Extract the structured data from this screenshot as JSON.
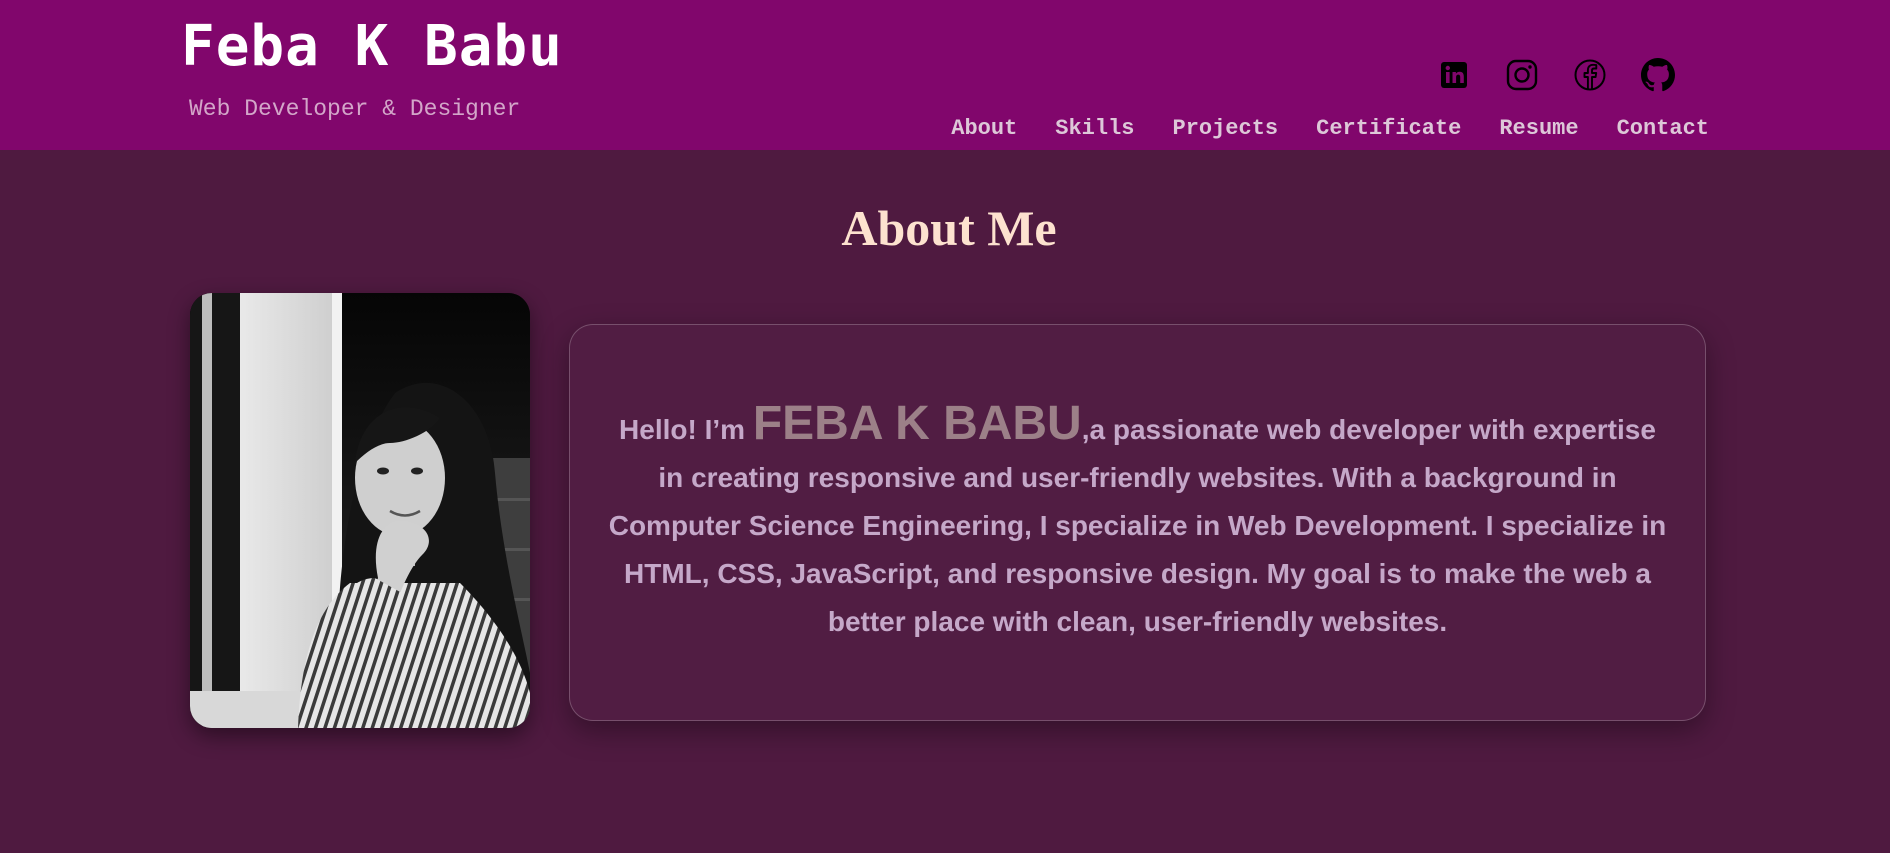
{
  "header": {
    "name": "Feba K Babu",
    "tagline": "Web Developer & Designer",
    "socials": [
      {
        "icon": "linkedin-icon"
      },
      {
        "icon": "instagram-icon"
      },
      {
        "icon": "facebook-icon"
      },
      {
        "icon": "github-icon"
      }
    ],
    "nav": [
      "About",
      "Skills",
      "Projects",
      "Certificate",
      "Resume",
      "Contact"
    ]
  },
  "about": {
    "title": "About Me",
    "greeting": "Hello! I’m ",
    "name": "FEBA K BABU",
    "body": ",a passionate web developer with expertise in creating responsive and user-friendly websites. With a background in Computer Science Engineering, I specialize in Web Development. I specialize in HTML, CSS, JavaScript, and responsive design. My goal is to make the web a better place with clean, user-friendly websites."
  },
  "colors": {
    "header_bg": "#81066c",
    "page_bg": "#4f1a40",
    "title": "#fde2cf",
    "body_text": "#c5a8c9",
    "name_highlight": "#9c8088",
    "nav_text": "#ddc7d8"
  }
}
